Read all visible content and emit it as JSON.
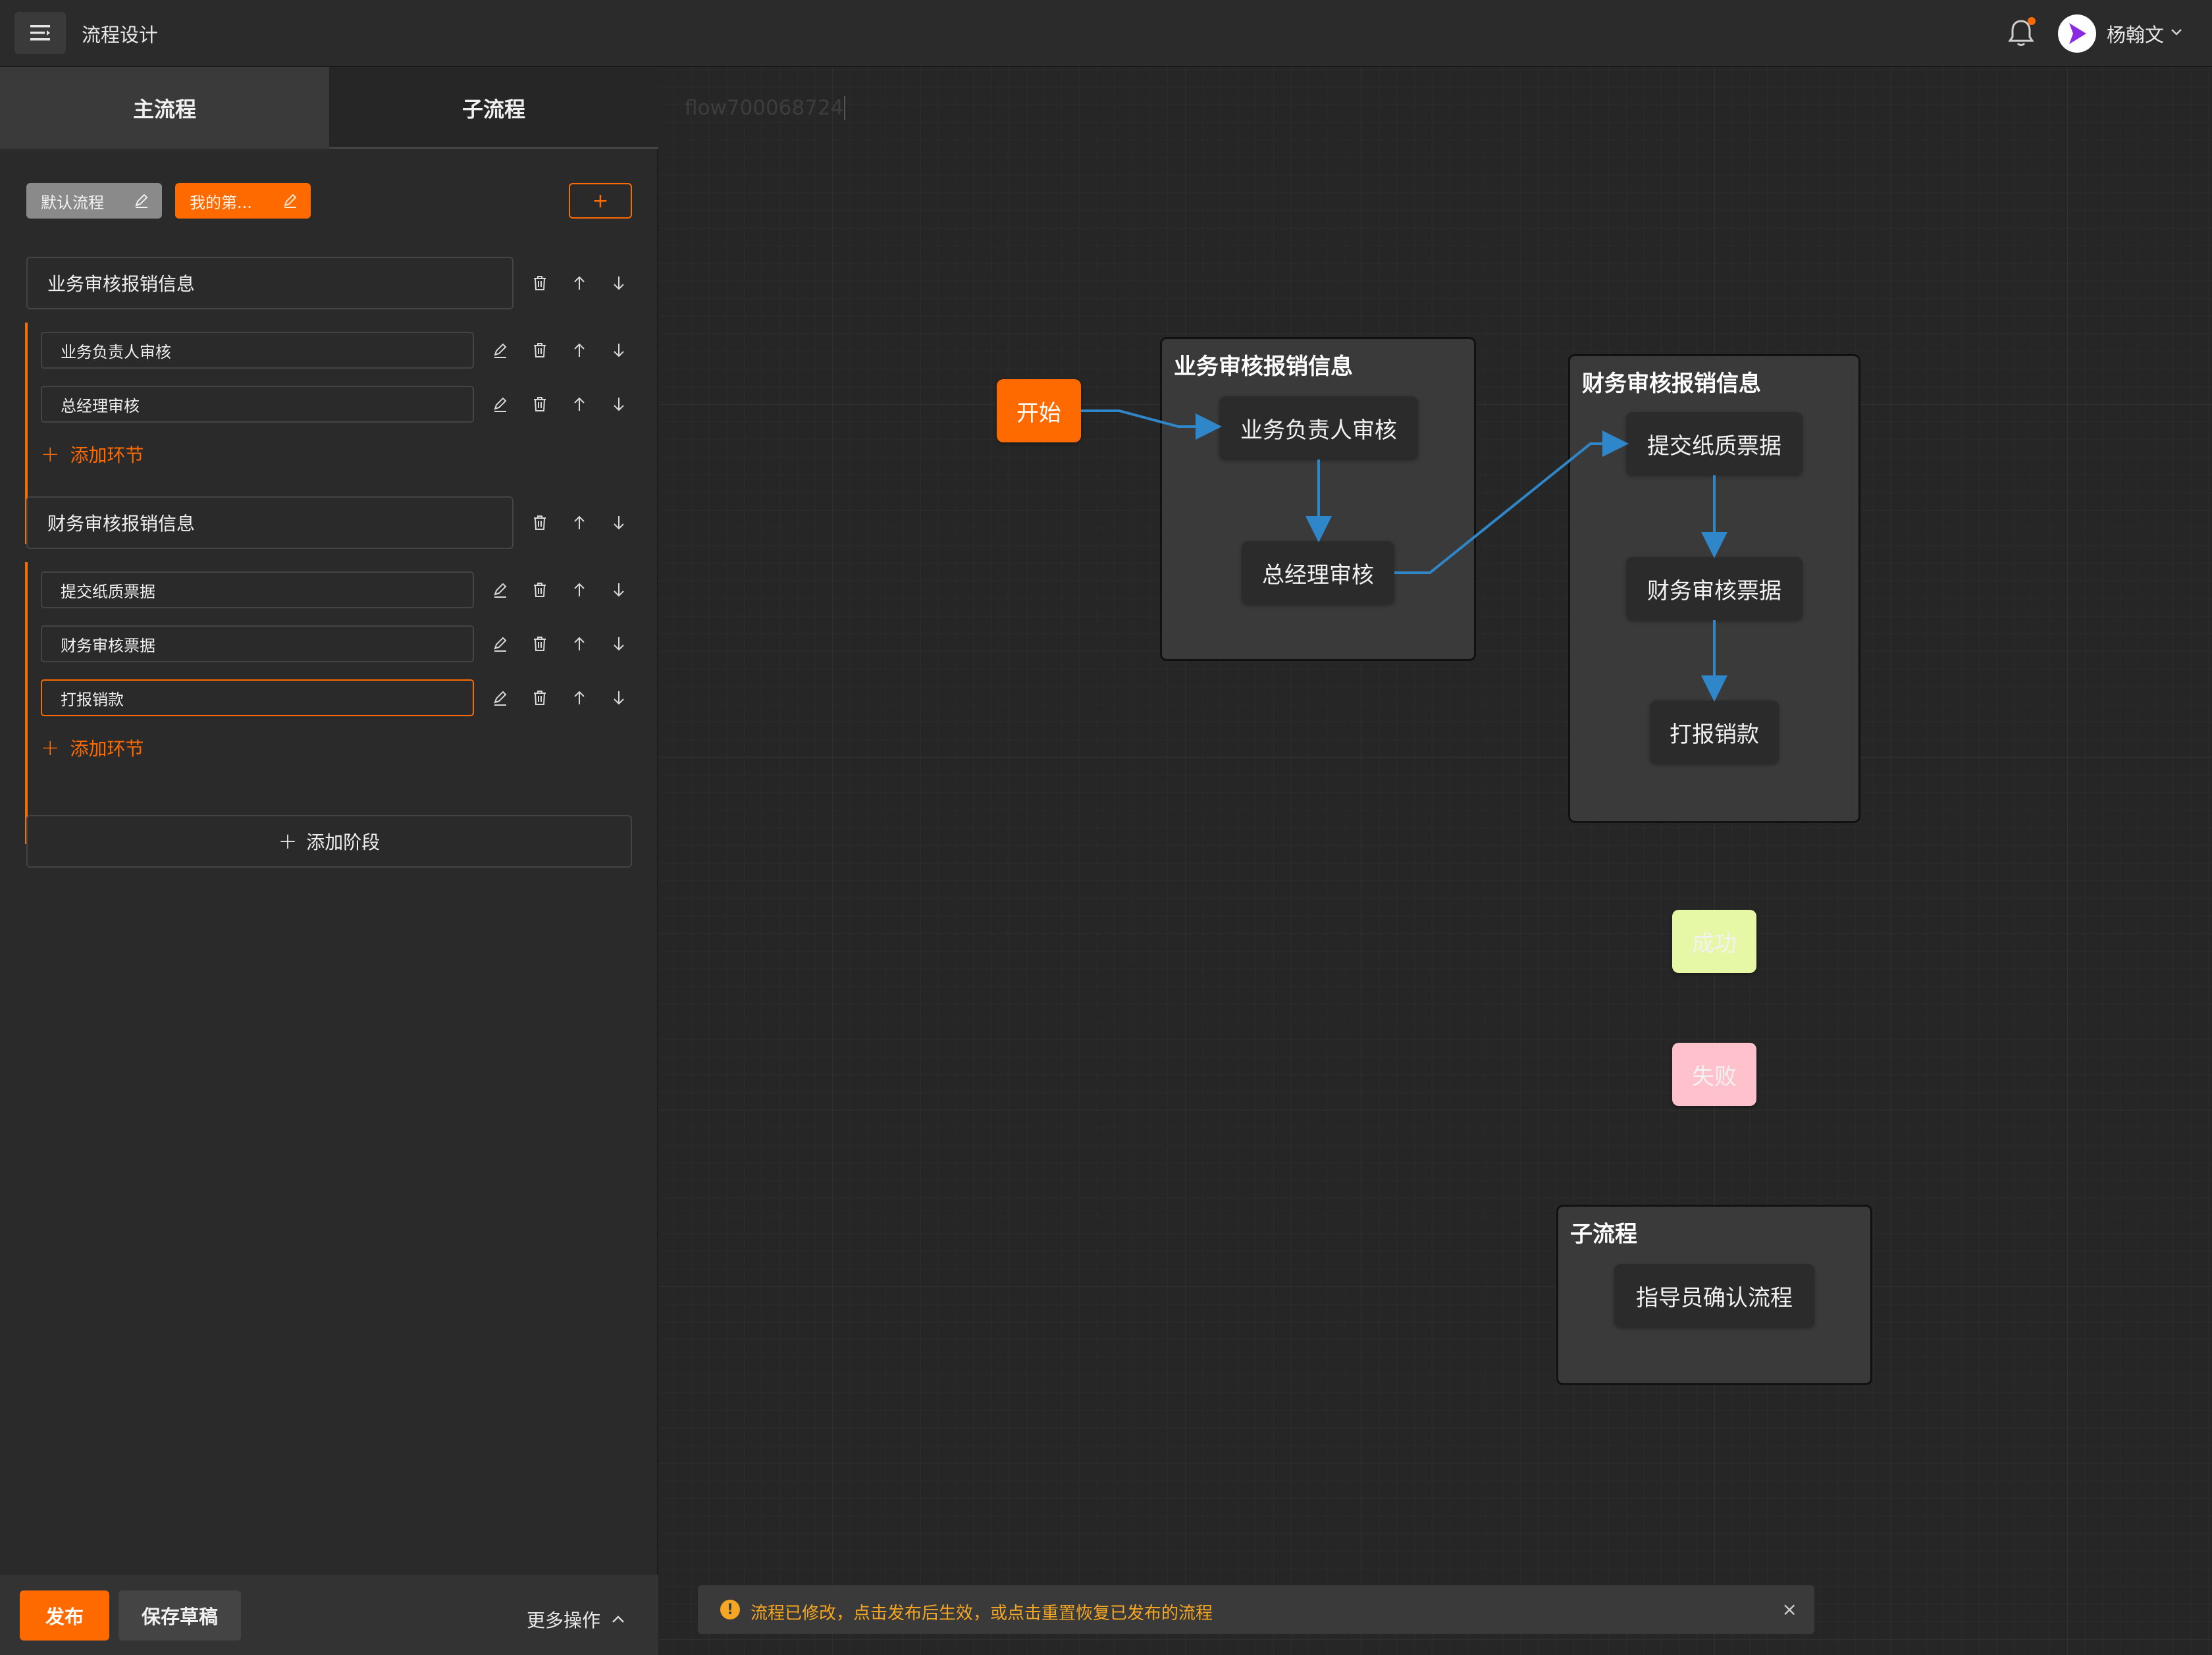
{
  "header": {
    "title": "流程设计",
    "user_name": "杨翰文",
    "colors": {
      "accent": "#ff6a00",
      "brand_logo": "#8a2be2"
    }
  },
  "tabs": [
    {
      "label": "主流程",
      "active": false
    },
    {
      "label": "子流程",
      "active": true
    }
  ],
  "flow_chips": [
    {
      "label": "默认流程"
    },
    {
      "label": "我的第..."
    }
  ],
  "add_flow_label": "+",
  "stages": [
    {
      "name": "业务审核报销信息",
      "steps": [
        "业务负责人审核",
        "总经理审核"
      ],
      "add_step_label": "添加环节"
    },
    {
      "name": "财务审核报销信息",
      "steps": [
        "提交纸质票据",
        "财务审核票据",
        "打报销款"
      ],
      "add_step_label": "添加环节"
    }
  ],
  "add_stage_label": "添加阶段",
  "bottom": {
    "publish": "发布",
    "save_draft": "保存草稿",
    "more_ops": "更多操作"
  },
  "canvas": {
    "flow_id": "flow700068724",
    "start": "开始",
    "groups": [
      {
        "title": "业务审核报销信息",
        "nodes": [
          "业务负责人审核",
          "总经理审核"
        ]
      },
      {
        "title": "财务审核报销信息",
        "nodes": [
          "提交纸质票据",
          "财务审核票据",
          "打报销款"
        ]
      },
      {
        "title": "子流程",
        "nodes": [
          "指导员确认流程"
        ]
      }
    ],
    "success": "成功",
    "fail": "失败",
    "edge_color": "#2f86c8"
  },
  "notice": {
    "message": "流程已修改，点击发布后生效，或点击重置恢复已发布的流程",
    "close": "×"
  }
}
